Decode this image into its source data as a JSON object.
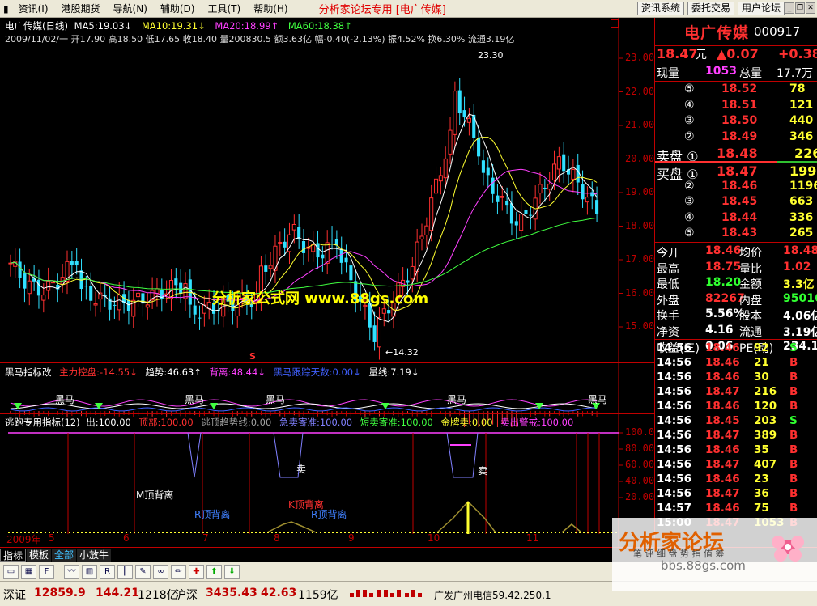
{
  "menu": {
    "items": [
      "资讯(I)",
      "港股期货",
      "导航(N)",
      "辅助(D)",
      "工具(T)",
      "帮助(H)"
    ],
    "title": "分析家论坛专用 [电广传媒]",
    "buttons": [
      "资讯系统",
      "委托交易",
      "用户论坛"
    ]
  },
  "chart": {
    "header": "电广传媒(日线)",
    "ma5": "MA5:19.03↓",
    "ma10": "MA10:19.31↓",
    "ma20": "MA20:18.99↑",
    "ma60": "MA60:18.38↑",
    "quote": "2009/11/02/一 开17.90 高18.50 低17.65 收18.40 量200830.5 额3.63亿 幅-0.40(-2.13%) 振4.52% 换6.30% 流通3.19亿",
    "high_label": "23.30",
    "low_label": "←14.32",
    "watermark": "分析家公式网 www.88gs.com",
    "price_axis": [
      "23.00",
      "22.00",
      "21.00",
      "20.00",
      "19.00",
      "18.00",
      "17.00",
      "16.00",
      "15.00"
    ],
    "s_marker": "S",
    "date_axis": [
      "2009年",
      "5",
      "6",
      "7",
      "8",
      "9",
      "10",
      "11"
    ],
    "colors": {
      "up": "#ff3030",
      "down": "#30e0ff",
      "ma5": "#ffffff",
      "ma10": "#ffff30",
      "ma20": "#ff40ff",
      "ma60": "#40ff40"
    }
  },
  "indicator1": {
    "name": "黑马指标改",
    "main": "主力控盘:-14.55↓",
    "trend": "趋势:46.63↑",
    "away": "背离:48.44↓",
    "days": "黑马跟踪天数:0.00↓",
    "vol": "量线:7.19↓",
    "labels": [
      "黑马",
      "黑马",
      "黑马",
      "黑马",
      "黑马"
    ]
  },
  "indicator2": {
    "name": "逃跑专用指标(12)",
    "out": "出:100.00",
    "top": "顶部:100.00",
    "escape": "逃顶趋势线:0.00",
    "sell": "急卖寄准:100.00",
    "short": "短卖寄准:100.00",
    "gold": "金牌卖:0.00",
    "warn": "卖出警戒:100.00",
    "axis": [
      "100.0",
      "80.00",
      "60.00",
      "40.00",
      "20.00"
    ],
    "notes": [
      "M顶背离",
      "R顶背离",
      "K顶背离",
      "R顶背离",
      "卖",
      "卖",
      "卖"
    ]
  },
  "quote_panel": {
    "name": "电广传媒",
    "code": "000917",
    "price": "18.47",
    "unit": "元",
    "change": "▲0.07",
    "change_pct": "+0.38",
    "xianliang_label": "现量",
    "xianliang": "1053",
    "zongliang_label": "总量",
    "zongliang": "17.7万",
    "sell": [
      {
        "label": "⑤",
        "price": "18.52",
        "vol": "78"
      },
      {
        "label": "④",
        "price": "18.51",
        "vol": "121"
      },
      {
        "label": "③",
        "price": "18.50",
        "vol": "440"
      },
      {
        "label": "②",
        "price": "18.49",
        "vol": "346"
      },
      {
        "label": "卖盘 ①",
        "price": "18.48",
        "vol": "226"
      }
    ],
    "buy": [
      {
        "label": "买盘 ①",
        "price": "18.47",
        "vol": "1995"
      },
      {
        "label": "②",
        "price": "18.46",
        "vol": "1196"
      },
      {
        "label": "③",
        "price": "18.45",
        "vol": "663"
      },
      {
        "label": "④",
        "price": "18.44",
        "vol": "336"
      },
      {
        "label": "⑤",
        "price": "18.43",
        "vol": "265"
      }
    ],
    "stats": [
      {
        "l1": "今开",
        "v1": "18.46",
        "l2": "均价",
        "v2": "18.48"
      },
      {
        "l1": "最高",
        "v1": "18.75",
        "l2": "量比",
        "v2": "1.02"
      },
      {
        "l1": "最低",
        "v1": "18.20",
        "l2": "金额",
        "v2": "3.3亿"
      },
      {
        "l1": "外盘",
        "v1": "82267",
        "l2": "内盘",
        "v2": "95016"
      },
      {
        "l1": "换手",
        "v1": "5.56%",
        "l2": "股本",
        "v2": "4.06亿"
      },
      {
        "l1": "净资",
        "v1": "4.16",
        "l2": "流通",
        "v2": "3.19亿"
      },
      {
        "l1": "收益(三)",
        "v1": "0.06",
        "l2": "PE(动)",
        "v2": "234.1"
      }
    ],
    "ticks": [
      {
        "t": "14:56",
        "p": "18.46",
        "v": "92",
        "s": "S"
      },
      {
        "t": "14:56",
        "p": "18.46",
        "v": "21",
        "s": "B"
      },
      {
        "t": "14:56",
        "p": "18.46",
        "v": "30",
        "s": "B"
      },
      {
        "t": "14:56",
        "p": "18.47",
        "v": "216",
        "s": "B"
      },
      {
        "t": "14:56",
        "p": "18.46",
        "v": "120",
        "s": "B"
      },
      {
        "t": "14:56",
        "p": "18.45",
        "v": "203",
        "s": "S"
      },
      {
        "t": "14:56",
        "p": "18.47",
        "v": "389",
        "s": "B"
      },
      {
        "t": "14:56",
        "p": "18.46",
        "v": "35",
        "s": "B"
      },
      {
        "t": "14:56",
        "p": "18.47",
        "v": "407",
        "s": "B"
      },
      {
        "t": "14:56",
        "p": "18.46",
        "v": "23",
        "s": "B"
      },
      {
        "t": "14:56",
        "p": "18.47",
        "v": "36",
        "s": "B"
      },
      {
        "t": "14:57",
        "p": "18.46",
        "v": "75",
        "s": "B"
      },
      {
        "t": "15:00",
        "p": "18.47",
        "v": "1053",
        "s": "B"
      }
    ]
  },
  "tabs": [
    "指标",
    "模板",
    "全部",
    "小放牛"
  ],
  "status": {
    "sz_label": "深证",
    "sz_value": "12859.9",
    "sz_change": "144.21",
    "sz_amount": "1218亿",
    "hs_label": "沪深",
    "hs_value": "3435.43",
    "hs_change": "42.63",
    "hs_amount": "1159亿",
    "server": "广发广州电信59.42.250.1"
  },
  "watermark2": {
    "title": "分析家论坛",
    "url": "bbs.88gs.com",
    "side": "日线",
    "nav": "笔 评 细 盘 势 指 值 筹"
  }
}
